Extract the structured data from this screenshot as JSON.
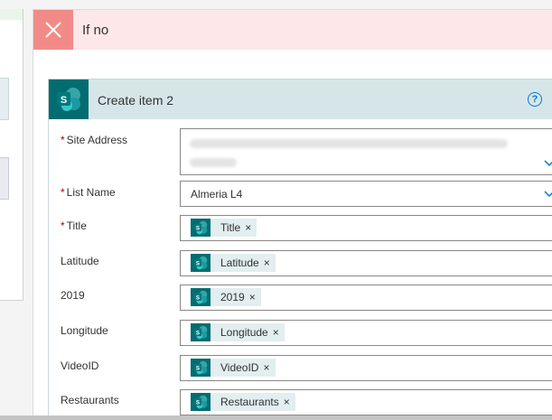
{
  "branch": {
    "title": "If no"
  },
  "action": {
    "title": "Create item 2",
    "fields": {
      "site_address": {
        "label": "Site Address",
        "required": true
      },
      "list_name": {
        "label": "List Name",
        "required": true,
        "value": "Almeria L4"
      },
      "title": {
        "label": "Title",
        "required": true,
        "token": "Title"
      },
      "latitude": {
        "label": "Latitude",
        "token": "Latitude"
      },
      "year": {
        "label": "2019",
        "token": "2019"
      },
      "longitude": {
        "label": "Longitude",
        "token": "Longitude"
      },
      "videoid": {
        "label": "VideoID",
        "token": "VideoID"
      },
      "restaurants": {
        "label": "Restaurants",
        "token": "Restaurants"
      }
    }
  },
  "ui": {
    "required_mark": "*",
    "token_remove": "×",
    "help": "?"
  },
  "colors": {
    "sharepoint_teal": "#036c70",
    "header_red": "#fde7e9",
    "card_header": "#d6e6e8",
    "accent": "#0078d4"
  },
  "icons": [
    "close-icon",
    "sharepoint-icon",
    "help-icon",
    "chevron-down-icon",
    "token-remove-icon"
  ]
}
